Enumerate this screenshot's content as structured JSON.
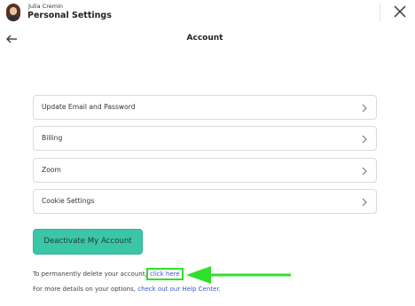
{
  "header": {
    "user_name": "Julia Cremin",
    "section_title": "Personal Settings"
  },
  "page": {
    "title": "Account"
  },
  "menu": {
    "items": [
      {
        "label": "Update Email and Password"
      },
      {
        "label": "Billing"
      },
      {
        "label": "Zoom"
      },
      {
        "label": "Cookie Settings"
      }
    ]
  },
  "actions": {
    "deactivate_label": "Deactivate My Account"
  },
  "footer": {
    "delete_prefix": "To permanently delete your account,",
    "delete_link": "click here",
    "help_prefix": "For more details on your options,",
    "help_link": "check out our Help Center",
    "help_suffix": "."
  },
  "colors": {
    "accent": "#3cc6a8",
    "link": "#3a56c8",
    "annotation": "#2fe02a"
  },
  "icons": [
    "close-icon",
    "back-arrow-icon",
    "chevron-right-icon",
    "annotation-arrow-icon"
  ]
}
